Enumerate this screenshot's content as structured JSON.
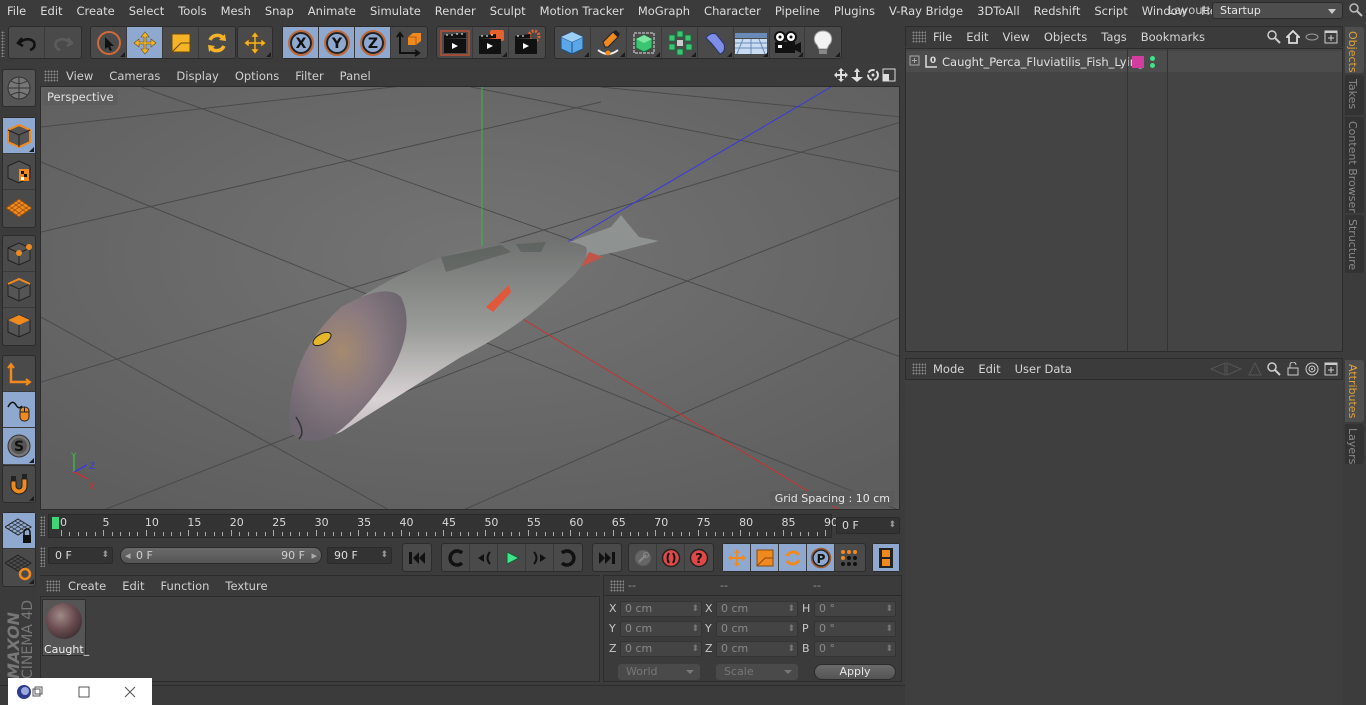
{
  "menubar": {
    "items": [
      "File",
      "Edit",
      "Create",
      "Select",
      "Tools",
      "Mesh",
      "Snap",
      "Animate",
      "Simulate",
      "Render",
      "Sculpt",
      "Motion Tracker",
      "MoGraph",
      "Character",
      "Pipeline",
      "Plugins",
      "V-Ray Bridge",
      "3DToAll",
      "Redshift",
      "Script",
      "Window",
      "Help"
    ],
    "layout_label": "Layout:",
    "layout_value": "Startup"
  },
  "toolbar": {
    "icons": {
      "undo": "undo-icon",
      "redo": "redo-icon",
      "select": "live-selection-icon",
      "move": "move-icon",
      "scale": "scale-icon",
      "rotate": "rotate-icon",
      "last_tool": "last-tool-move-icon",
      "x_lock": "x-axis-icon",
      "y_lock": "y-axis-icon",
      "z_lock": "z-axis-icon",
      "coord_system": "coordinate-system-icon",
      "render_view": "render-view-icon",
      "render_picture_viewer": "render-to-picture-viewer-icon",
      "render_settings": "render-settings-icon",
      "cube": "cube-icon",
      "pen": "pen-spline-icon",
      "subdivision": "subdivision-surface-icon",
      "cloner": "cloner-icon",
      "deformer": "bend-deformer-icon",
      "floor": "floor-icon",
      "camera": "camera-icon",
      "light": "light-icon"
    }
  },
  "left_toolbar": {
    "items": [
      "make-editable-icon",
      "model-mode-icon",
      "texture-mode-icon",
      "workplane-mode-icon",
      "points-mode-icon",
      "edges-mode-icon",
      "polygons-mode-icon",
      "axis-mode-icon",
      "tweak-mode-icon",
      "solo-icon",
      "snap-icon",
      "lock-workplane-icon",
      "workplane-sync-icon"
    ],
    "brand": [
      "MAXON",
      "CINEMA 4D"
    ]
  },
  "viewport": {
    "menu": [
      "View",
      "Cameras",
      "Display",
      "Options",
      "Filter",
      "Panel"
    ],
    "camera_label": "Perspective",
    "grid_spacing": "Grid Spacing : 10 cm",
    "axis_labels": {
      "x": "X",
      "y": "Y",
      "z": "Z"
    }
  },
  "timeline": {
    "ticks": [
      "0",
      "5",
      "10",
      "15",
      "20",
      "25",
      "30",
      "35",
      "40",
      "45",
      "50",
      "55",
      "60",
      "65",
      "70",
      "75",
      "80",
      "85",
      "90"
    ],
    "current_frame": "0 F",
    "start_frame": "0 F",
    "range_start": "0 F",
    "range_end": "90 F",
    "end_frame": "90 F"
  },
  "material_manager": {
    "menu": [
      "Create",
      "Edit",
      "Function",
      "Texture"
    ],
    "materials": [
      {
        "name": "Caught_"
      }
    ]
  },
  "coordinates": {
    "headers": [
      "--",
      "--",
      "--"
    ],
    "rows": [
      {
        "l1": "X",
        "v1": "0 cm",
        "l2": "X",
        "v2": "0 cm",
        "l3": "H",
        "v3": "0 °"
      },
      {
        "l1": "Y",
        "v1": "0 cm",
        "l2": "Y",
        "v2": "0 cm",
        "l3": "P",
        "v3": "0 °"
      },
      {
        "l1": "Z",
        "v1": "0 cm",
        "l2": "Z",
        "v2": "0 cm",
        "l3": "B",
        "v3": "0 °"
      }
    ],
    "mode": "World",
    "transform": "Scale",
    "apply": "Apply"
  },
  "objects_panel": {
    "menu": [
      "File",
      "Edit",
      "View",
      "Objects",
      "Tags",
      "Bookmarks"
    ],
    "objects": [
      {
        "name": "Caught_Perca_Fluviatilis_Fish_Lying",
        "tag_color": "#d23d9f"
      }
    ]
  },
  "attributes_panel": {
    "menu": [
      "Mode",
      "Edit",
      "User Data"
    ]
  },
  "side_tabs": {
    "top": [
      {
        "label": "Objects",
        "active": true
      },
      {
        "label": "Takes"
      },
      {
        "label": "Content Browser"
      },
      {
        "label": "Structure"
      }
    ],
    "bottom": [
      {
        "label": "Attributes",
        "active": true
      },
      {
        "label": "Layers"
      }
    ]
  },
  "colors": {
    "accent_active": "#8ea8cf",
    "tab_active_text": "#e0a23c",
    "playhead": "#3fd776"
  }
}
